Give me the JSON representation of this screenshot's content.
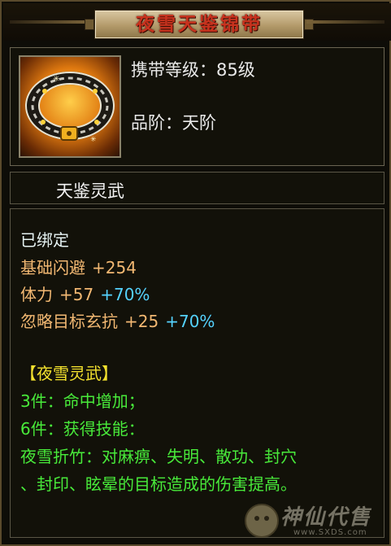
{
  "window": {
    "title": "夜雪天鉴锦带"
  },
  "item": {
    "icon": "golden-belt-icon",
    "level_requirement": "携带等级：85级",
    "grade": "品阶：天阶"
  },
  "set": {
    "name": "天鉴灵武"
  },
  "attributes": {
    "bound_status": "已绑定",
    "base_stats": [
      {
        "label": "基础闪避",
        "value": "+254",
        "bonus": ""
      },
      {
        "label": "体力",
        "value": "+57",
        "bonus": "+70%"
      },
      {
        "label": "忽略目标玄抗",
        "value": "+25",
        "bonus": "+70%"
      }
    ],
    "set_title": "【夜雪灵武】",
    "set_effects": [
      "3件：命中增加；",
      "6件：获得技能：",
      "夜雪折竹：对麻痹、失明、散功、封穴",
      "、封印、眩晕的目标造成的伤害提高。"
    ]
  },
  "watermark": {
    "title": "神仙代售",
    "url": "www.SXDS.com"
  },
  "colors": {
    "title_text": "#c8321e",
    "white_text": "#e6f3f3",
    "attribute_text": "#f2b872",
    "bonus_text": "#55d3ff",
    "set_title_text": "#f3e12e",
    "set_effect_text": "#48ea3a"
  }
}
